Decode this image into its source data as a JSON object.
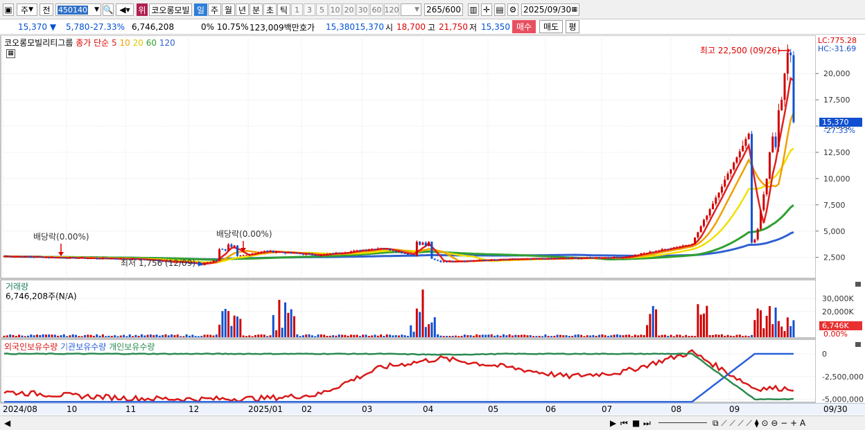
{
  "toolbar": {
    "type_label": "주",
    "prev_label": "전",
    "code_value": "450140",
    "rank_label": "위",
    "stock_name": "코오롱모빌",
    "periods": [
      "일",
      "주",
      "월",
      "년",
      "분",
      "초",
      "틱"
    ],
    "numbers": [
      "1",
      "3",
      "5",
      "10",
      "20",
      "30",
      "60",
      "120"
    ],
    "count_value": "265",
    "count_total": "/600",
    "date_value": "2025/09/30"
  },
  "quote": {
    "price": "15,370",
    "change": "5,780",
    "change_pct": "-27.33%",
    "volume": "6,746,208",
    "turnover": "0% 10.75%",
    "amount": "123,009백만",
    "hoga_label": "호가",
    "ask": "15,380",
    "bid": "15,370",
    "open_label": "시",
    "open": "18,700",
    "high_label": "고",
    "high": "21,750",
    "low_label": "저",
    "low": "15,350",
    "buy_label": "매수",
    "sell_label": "매도",
    "eval_label": "평"
  },
  "price_panel": {
    "legend_name": "코오롱모빌리티그룹",
    "legend_ma_label": "종가 단순",
    "ma_periods": [
      "5",
      "10",
      "20",
      "60",
      "120"
    ],
    "lc_text": "LC:775.28",
    "hc_text": "HC:-31.69",
    "high_annotation": "최고 22,500 (09/26)",
    "low_annotation": "최저 1,756 (12/09)",
    "dividend_label_1": "배당락(0.00%)",
    "dividend_label_2": "배당락(0.00%)",
    "current_price_tag": "15,370",
    "current_pct_tag": "-27.33%",
    "y_ticks": [
      "20,000",
      "17,500",
      "15,000",
      "12,500",
      "10,000",
      "7,500",
      "5,000",
      "2,500"
    ]
  },
  "volume_panel": {
    "title": "거래량",
    "value_text": "6,746,208주(N/A)",
    "y_ticks": [
      "30,000K",
      "20,000K"
    ],
    "current_tag": "6,746K",
    "zero_tag": "0.00%"
  },
  "holding_panel": {
    "series_labels": [
      "외국인보유수량",
      "기관보유수량",
      "개인보유수량"
    ],
    "y_ticks": [
      "0",
      "-2,500,000",
      "-5,000,000"
    ]
  },
  "x_axis": {
    "labels": [
      "2024/08",
      "10",
      "11",
      "12",
      "2025/01",
      "02",
      "03",
      "04",
      "05",
      "06",
      "07",
      "08",
      "09"
    ],
    "end_label": "09/30"
  },
  "colors": {
    "ma5": "#e02020",
    "ma10": "#f0a000",
    "ma20": "#f0e000",
    "ma60": "#30a030",
    "ma120": "#3060d0",
    "up": "#d00000",
    "down": "#1050d0",
    "foreign": "#d81818",
    "institution": "#2860d8",
    "individual": "#2a8a50"
  },
  "chart_data": [
    {
      "type": "candlestick-line",
      "title": "코오롱모빌리티그룹 일봉",
      "x_labels": [
        "2024/08",
        "10",
        "11",
        "12",
        "2025/01",
        "02",
        "03",
        "04",
        "05",
        "06",
        "07",
        "08",
        "09"
      ],
      "ylim": [
        1000,
        22500
      ],
      "close_series": [
        {
          "date": "2024/08",
          "value": 2600
        },
        {
          "date": "10",
          "value": 2450
        },
        {
          "date": "11",
          "value": 2350
        },
        {
          "date": "12",
          "value": 1900
        },
        {
          "date": "2025/01",
          "value": 3100
        },
        {
          "date": "02",
          "value": 2700
        },
        {
          "date": "03",
          "value": 3400
        },
        {
          "date": "04",
          "value": 2100
        },
        {
          "date": "05",
          "value": 2300
        },
        {
          "date": "06",
          "value": 2400
        },
        {
          "date": "07",
          "value": 2500
        },
        {
          "date": "08",
          "value": 3800
        },
        {
          "date": "09",
          "value": 15370
        }
      ],
      "high": 22500,
      "low": 1756
    },
    {
      "type": "bar",
      "title": "거래량",
      "ylim": [
        0,
        35000
      ],
      "unit": "K"
    },
    {
      "type": "line",
      "title": "보유수량",
      "series": [
        {
          "name": "외국인보유수량",
          "values": [
            -4200000,
            -4600000,
            -4900000,
            -5000000,
            -4900000,
            -4500000,
            -1500000,
            -500000,
            -1500000,
            -2500000,
            -2000000,
            200000,
            -3800000
          ]
        },
        {
          "name": "기관보유수량",
          "values": [
            -5300000,
            -5300000,
            -5300000,
            -5300000,
            -5300000,
            -5300000,
            -5300000,
            -5300000,
            -5300000,
            -5300000,
            -5300000,
            -5300000,
            0
          ]
        },
        {
          "name": "개인보유수량",
          "values": [
            0,
            0,
            0,
            0,
            0,
            0,
            0,
            -100000,
            0,
            0,
            0,
            0,
            -5000000
          ]
        }
      ],
      "ylim": [
        -5500000,
        500000
      ]
    }
  ]
}
